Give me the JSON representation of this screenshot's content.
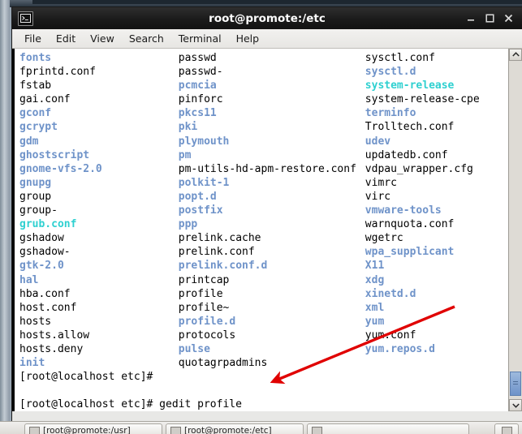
{
  "window": {
    "title": "root@promote:/etc",
    "icon": "terminal-icon",
    "buttons": {
      "minimize": "minimize-icon",
      "maximize": "maximize-icon",
      "close": "close-icon"
    }
  },
  "menubar": {
    "items": [
      "File",
      "Edit",
      "View",
      "Search",
      "Terminal",
      "Help"
    ]
  },
  "colors": {
    "file": "#000000",
    "directory": "#6f93c9",
    "symlink": "#2ed0d0",
    "annotation": "#e00000",
    "terminal_bg": "#ffffff",
    "titlebar_bg": "#1b1b1b"
  },
  "terminal": {
    "columns": [
      [
        {
          "name": "fonts",
          "type": "directory"
        },
        {
          "name": "fprintd.conf",
          "type": "file"
        },
        {
          "name": "fstab",
          "type": "file"
        },
        {
          "name": "gai.conf",
          "type": "file"
        },
        {
          "name": "gconf",
          "type": "directory"
        },
        {
          "name": "gcrypt",
          "type": "directory"
        },
        {
          "name": "gdm",
          "type": "directory"
        },
        {
          "name": "ghostscript",
          "type": "directory"
        },
        {
          "name": "gnome-vfs-2.0",
          "type": "directory"
        },
        {
          "name": "gnupg",
          "type": "directory"
        },
        {
          "name": "group",
          "type": "file"
        },
        {
          "name": "group-",
          "type": "file"
        },
        {
          "name": "grub.conf",
          "type": "symlink"
        },
        {
          "name": "gshadow",
          "type": "file"
        },
        {
          "name": "gshadow-",
          "type": "file"
        },
        {
          "name": "gtk-2.0",
          "type": "directory"
        },
        {
          "name": "hal",
          "type": "directory"
        },
        {
          "name": "hba.conf",
          "type": "file"
        },
        {
          "name": "host.conf",
          "type": "file"
        },
        {
          "name": "hosts",
          "type": "file"
        },
        {
          "name": "hosts.allow",
          "type": "file"
        },
        {
          "name": "hosts.deny",
          "type": "file"
        },
        {
          "name": "init",
          "type": "directory"
        }
      ],
      [
        {
          "name": "passwd",
          "type": "file"
        },
        {
          "name": "passwd-",
          "type": "file"
        },
        {
          "name": "pcmcia",
          "type": "directory"
        },
        {
          "name": "pinforc",
          "type": "file"
        },
        {
          "name": "pkcs11",
          "type": "directory"
        },
        {
          "name": "pki",
          "type": "directory"
        },
        {
          "name": "plymouth",
          "type": "directory"
        },
        {
          "name": "pm",
          "type": "directory"
        },
        {
          "name": "pm-utils-hd-apm-restore.conf",
          "type": "file"
        },
        {
          "name": "polkit-1",
          "type": "directory"
        },
        {
          "name": "popt.d",
          "type": "directory"
        },
        {
          "name": "postfix",
          "type": "directory"
        },
        {
          "name": "ppp",
          "type": "directory"
        },
        {
          "name": "prelink.cache",
          "type": "file"
        },
        {
          "name": "prelink.conf",
          "type": "file"
        },
        {
          "name": "prelink.conf.d",
          "type": "directory"
        },
        {
          "name": "printcap",
          "type": "file"
        },
        {
          "name": "profile",
          "type": "file"
        },
        {
          "name": "profile~",
          "type": "file"
        },
        {
          "name": "profile.d",
          "type": "directory"
        },
        {
          "name": "protocols",
          "type": "file"
        },
        {
          "name": "pulse",
          "type": "directory"
        },
        {
          "name": "quotagrpadmins",
          "type": "file"
        }
      ],
      [
        {
          "name": "sysctl.conf",
          "type": "file"
        },
        {
          "name": "sysctl.d",
          "type": "directory"
        },
        {
          "name": "system-release",
          "type": "symlink"
        },
        {
          "name": "system-release-cpe",
          "type": "file"
        },
        {
          "name": "terminfo",
          "type": "directory"
        },
        {
          "name": "Trolltech.conf",
          "type": "file"
        },
        {
          "name": "udev",
          "type": "directory"
        },
        {
          "name": "updatedb.conf",
          "type": "file"
        },
        {
          "name": "vdpau_wrapper.cfg",
          "type": "file"
        },
        {
          "name": "vimrc",
          "type": "file"
        },
        {
          "name": "virc",
          "type": "file"
        },
        {
          "name": "vmware-tools",
          "type": "directory"
        },
        {
          "name": "warnquota.conf",
          "type": "file"
        },
        {
          "name": "wgetrc",
          "type": "file"
        },
        {
          "name": "wpa_supplicant",
          "type": "directory"
        },
        {
          "name": "X11",
          "type": "directory"
        },
        {
          "name": "xdg",
          "type": "directory"
        },
        {
          "name": "xinetd.d",
          "type": "directory"
        },
        {
          "name": "xml",
          "type": "directory"
        },
        {
          "name": "yum",
          "type": "directory"
        },
        {
          "name": "yum.conf",
          "type": "file"
        },
        {
          "name": "yum.repos.d",
          "type": "directory"
        }
      ]
    ],
    "prompt_lines": [
      "[root@localhost etc]#",
      "",
      "[root@localhost etc]# gedit profile",
      "[root@localhost etc]# gedit profile"
    ],
    "cursor_visible": true
  },
  "scrollbar": {
    "up_arrow": "chevron-up-icon",
    "down_arrow": "chevron-down-icon"
  },
  "taskbar": {
    "buttons": [
      {
        "label": "[root@promote:/usr]",
        "icon": "window-icon"
      },
      {
        "label": "[root@promote:/etc]",
        "icon": "window-icon"
      },
      {
        "label": "",
        "icon": "window-icon"
      }
    ],
    "tray_icon": "window-list-icon"
  }
}
